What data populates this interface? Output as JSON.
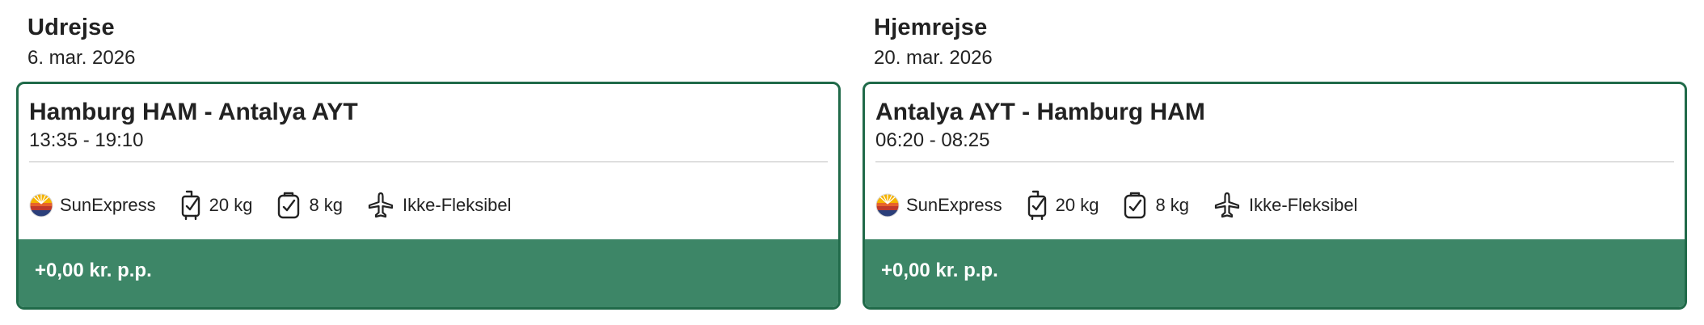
{
  "outbound": {
    "heading": "Udrejse",
    "date": "6. mar. 2026",
    "route": "Hamburg HAM - Antalya AYT",
    "times": "13:35 - 19:10",
    "airline": "SunExpress",
    "checked_bag": "20 kg",
    "cabin_bag": "8 kg",
    "flexibility": "Ikke-Fleksibel",
    "price": "+0,00 kr. p.p."
  },
  "return": {
    "heading": "Hjemrejse",
    "date": "20. mar. 2026",
    "route": "Antalya AYT - Hamburg HAM",
    "times": "06:20 - 08:25",
    "airline": "SunExpress",
    "checked_bag": "20 kg",
    "cabin_bag": "8 kg",
    "flexibility": "Ikke-Fleksibel",
    "price": "+0,00 kr. p.p."
  },
  "colors": {
    "accent_border": "#206a49",
    "price_bar": "#3d8667",
    "divider": "#dedede"
  },
  "icons": [
    "sunexpress-logo",
    "checked-bag-icon",
    "cabin-bag-icon",
    "plane-icon"
  ]
}
